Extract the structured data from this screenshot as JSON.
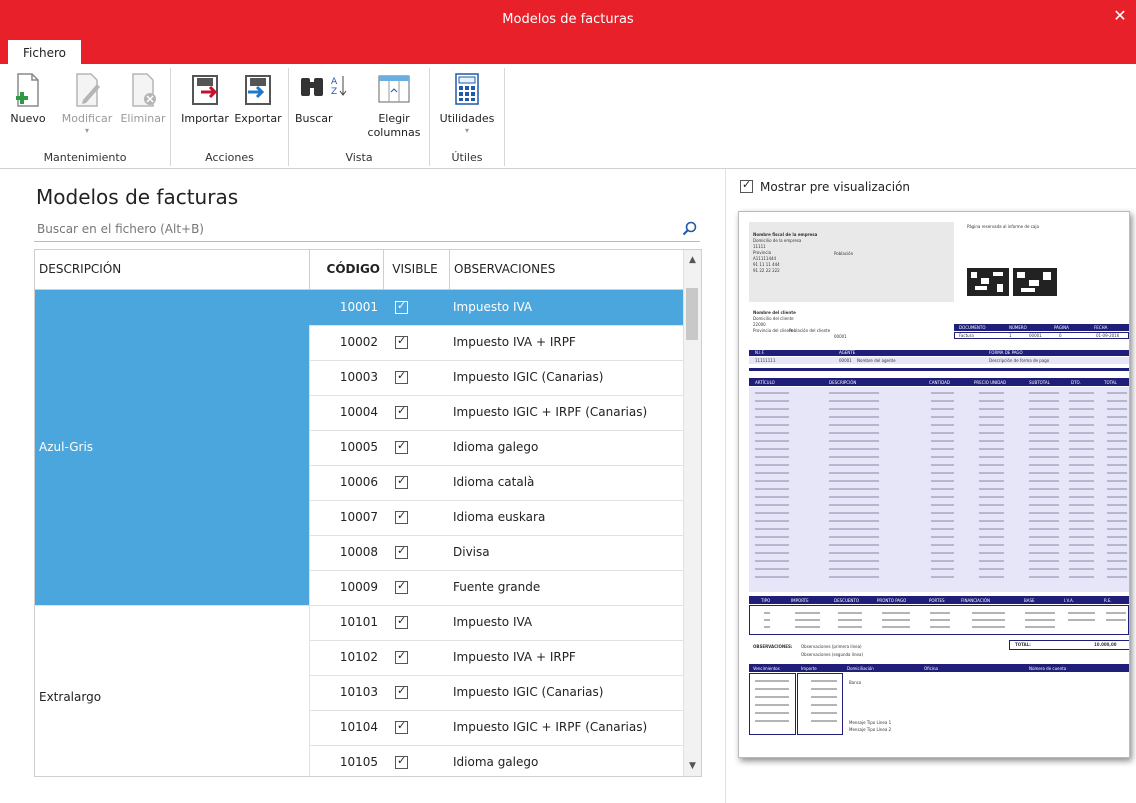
{
  "window": {
    "title": "Modelos de facturas"
  },
  "ribbon_tab": "Fichero",
  "ribbon": {
    "groups": [
      {
        "label": "Mantenimiento",
        "buttons": [
          "Nuevo",
          "Modificar",
          "Eliminar"
        ]
      },
      {
        "label": "Acciones",
        "buttons": [
          "Importar",
          "Exportar"
        ]
      },
      {
        "label": "Vista",
        "buttons": [
          "Buscar",
          "Elegir columnas"
        ]
      },
      {
        "label": "Útiles",
        "buttons": [
          "Utilidades"
        ]
      }
    ]
  },
  "page": {
    "title": "Modelos de facturas",
    "search_placeholder": "Buscar en el fichero (Alt+B)"
  },
  "table": {
    "headers": [
      "DESCRIPCIÓN",
      "CÓDIGO",
      "VISIBLE",
      "OBSERVACIONES"
    ],
    "groups": [
      {
        "name": "Azul-Gris",
        "selected": true
      },
      {
        "name": "Extralargo",
        "selected": false
      }
    ],
    "rows": [
      {
        "code": "10001",
        "visible": true,
        "obs": "Impuesto IVA",
        "selected": true
      },
      {
        "code": "10002",
        "visible": true,
        "obs": "Impuesto IVA + IRPF"
      },
      {
        "code": "10003",
        "visible": true,
        "obs": "Impuesto IGIC (Canarias)"
      },
      {
        "code": "10004",
        "visible": true,
        "obs": "Impuesto IGIC + IRPF (Canarias)"
      },
      {
        "code": "10005",
        "visible": true,
        "obs": "Idioma galego"
      },
      {
        "code": "10006",
        "visible": true,
        "obs": "Idioma català"
      },
      {
        "code": "10007",
        "visible": true,
        "obs": "Idioma euskara"
      },
      {
        "code": "10008",
        "visible": true,
        "obs": "Divisa"
      },
      {
        "code": "10009",
        "visible": true,
        "obs": "Fuente grande"
      },
      {
        "code": "10101",
        "visible": true,
        "obs": "Impuesto IVA"
      },
      {
        "code": "10102",
        "visible": true,
        "obs": "Impuesto IVA + IRPF"
      },
      {
        "code": "10103",
        "visible": true,
        "obs": "Impuesto IGIC (Canarias)"
      },
      {
        "code": "10104",
        "visible": true,
        "obs": "Impuesto IGIC + IRPF (Canarias)"
      },
      {
        "code": "10105",
        "visible": true,
        "obs": "Idioma galego"
      }
    ]
  },
  "preview": {
    "checkbox_label": "Mostrar pre visualización",
    "checked": true,
    "doc": {
      "company": [
        "Nombre fiscal de la empresa",
        "Domicilio de la empresa",
        "11111",
        "Provincia",
        "A11111444",
        "91 11 11 444",
        "91 22 22 222"
      ],
      "company_city": "Población",
      "reserved": "Página reservada al informe de caja",
      "client": [
        "Nombre del cliente",
        "Domicilio del cliente",
        "22000",
        "Provincia del cliente"
      ],
      "client_city": "Población del cliente",
      "client_code": "00001",
      "doc_headers": [
        "DOCUMENTO",
        "NÚMERO",
        "PÁGINA",
        "FECHA"
      ],
      "doc_values": [
        "Factura",
        "1",
        "00001",
        "0",
        "01-09-2016"
      ],
      "nif_headers": [
        "N.I.F.",
        "AGENTE",
        "FORMA DE PAGO"
      ],
      "nif_values": [
        "11111111",
        "00001",
        "Nombre del agente",
        "Descripción de forma de pago"
      ],
      "item_headers": [
        "ARTÍCULO",
        "DESCRIPCIÓN",
        "CANTIDAD",
        "PRECIO UNIDAD",
        "SUBTOTAL",
        "DTO.",
        "TOTAL"
      ],
      "tax_headers": [
        "TIPO",
        "IMPORTE",
        "DESCUENTO",
        "PRONTO PAGO",
        "PORTES",
        "FINANCIACIÓN",
        "BASE",
        "I.V.A.",
        "R.E."
      ],
      "observaciones_label": "OBSERVACIONES:",
      "observaciones": [
        "Observaciones (primera línea)",
        "Observaciones (segunda línea)"
      ],
      "total_label": "TOTAL:",
      "total_value": "10.000,00",
      "venc_headers": [
        "Vencimientos",
        "Importe",
        "Domiciliación",
        "Oficina",
        "Número de cuenta"
      ],
      "banco": "Banco",
      "messages": [
        "Mensaje Tipo Línea 1",
        "Mensaje Tipo Línea 2"
      ]
    }
  },
  "colors": {
    "brand_red": "#e8202a",
    "selection_blue": "#4aa6dc",
    "invoice_navy": "#1f1f7a"
  }
}
